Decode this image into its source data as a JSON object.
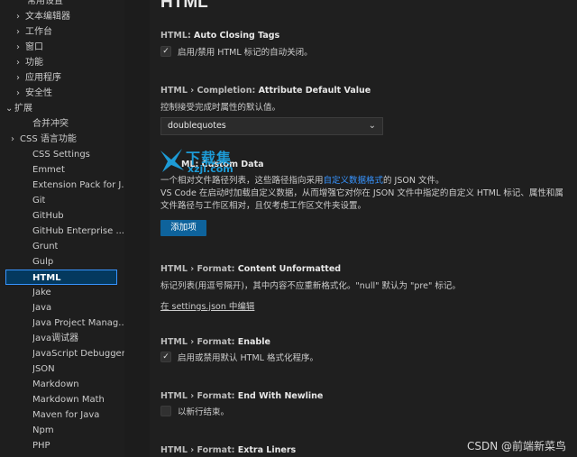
{
  "sidebar": {
    "items": [
      {
        "label": "常用设置",
        "chevron": ""
      },
      {
        "label": "文本编辑器",
        "chevron": "›"
      },
      {
        "label": "工作台",
        "chevron": "›"
      },
      {
        "label": "窗口",
        "chevron": "›"
      },
      {
        "label": "功能",
        "chevron": "›"
      },
      {
        "label": "应用程序",
        "chevron": "›"
      },
      {
        "label": "安全性",
        "chevron": "›"
      },
      {
        "label": "扩展",
        "chevron": "⌄"
      },
      {
        "label": "合并冲突",
        "chevron": ""
      },
      {
        "label": "CSS 语言功能",
        "chevron": "›"
      },
      {
        "label": "CSS Settings",
        "chevron": ""
      },
      {
        "label": "Emmet",
        "chevron": ""
      },
      {
        "label": "Extension Pack for J...",
        "chevron": ""
      },
      {
        "label": "Git",
        "chevron": ""
      },
      {
        "label": "GitHub",
        "chevron": ""
      },
      {
        "label": "GitHub Enterprise ...",
        "chevron": ""
      },
      {
        "label": "Grunt",
        "chevron": ""
      },
      {
        "label": "Gulp",
        "chevron": ""
      },
      {
        "label": "HTML",
        "chevron": ""
      },
      {
        "label": "Jake",
        "chevron": ""
      },
      {
        "label": "Java",
        "chevron": ""
      },
      {
        "label": "Java Project Manag...",
        "chevron": ""
      },
      {
        "label": "Java调试器",
        "chevron": ""
      },
      {
        "label": "JavaScript Debugger",
        "chevron": ""
      },
      {
        "label": "JSON",
        "chevron": ""
      },
      {
        "label": "Markdown",
        "chevron": ""
      },
      {
        "label": "Markdown Math",
        "chevron": ""
      },
      {
        "label": "Maven for Java",
        "chevron": ""
      },
      {
        "label": "Npm",
        "chevron": ""
      },
      {
        "label": "PHP",
        "chevron": ""
      }
    ]
  },
  "main": {
    "title": "HTML",
    "s1": {
      "category": "HTML: ",
      "name": "Auto Closing Tags",
      "label": "启用/禁用 HTML 标记的自动关闭。",
      "checked": true
    },
    "s2": {
      "category": "HTML › Completion: ",
      "name": "Attribute Default Value",
      "desc": "控制接受完成时属性的默认值。",
      "value": "doublequotes"
    },
    "s3": {
      "name": "ML: Custom Data",
      "desc1_pre": "一个相对文件路径列表，这些路径指向采用",
      "desc1_link": "自定义数据格式",
      "desc1_post": "的 JSON 文件。",
      "desc2": "VS Code 在启动时加载自定义数据，从而增强它对你在 JSON 文件中指定的自定义 HTML 标记、属性和属",
      "desc3": "文件路径与工作区相对，且仅考虑工作区文件夹设置。",
      "button": "添加项"
    },
    "s4": {
      "category": "HTML › Format: ",
      "name": "Content Unformatted",
      "desc": "标记列表(用逗号隔开)，其中内容不应重新格式化。\"null\" 默认为 \"pre\" 标记。",
      "link": "在 settings.json 中编辑"
    },
    "s5": {
      "category": "HTML › Format: ",
      "name": "Enable",
      "label": "启用或禁用默认 HTML 格式化程序。",
      "checked": true
    },
    "s6": {
      "category": "HTML › Format: ",
      "name": "End With Newline",
      "label": "以新行结束。",
      "checked": false
    },
    "s7": {
      "category": "HTML › Format: ",
      "name": "Extra Liners"
    }
  },
  "watermark": {
    "line1": "下载集",
    "line2": "xzji.com"
  },
  "footer": {
    "csdn": "CSDN @前端新菜鸟"
  },
  "colors": {
    "accent": "#3794ff",
    "button": "#0e639c",
    "watermark": "#1d9bd6"
  }
}
